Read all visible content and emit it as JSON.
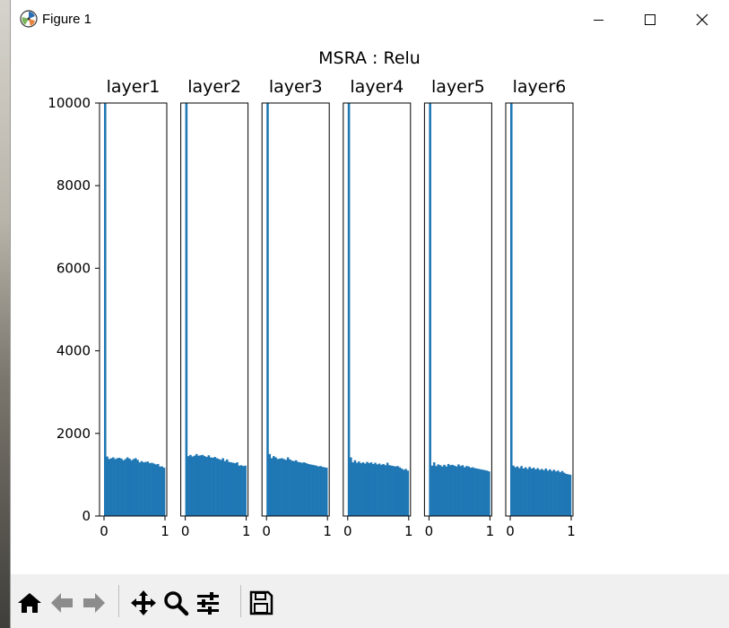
{
  "window": {
    "title": "Figure 1",
    "coords": ""
  },
  "toolbar": {
    "buttons": [
      {
        "name": "home",
        "icon": "home-icon"
      },
      {
        "name": "back",
        "icon": "arrow-left-icon"
      },
      {
        "name": "forward",
        "icon": "arrow-right-icon"
      },
      {
        "name": "pan",
        "icon": "move-icon"
      },
      {
        "name": "zoom",
        "icon": "magnifier-icon"
      },
      {
        "name": "configure",
        "icon": "sliders-icon"
      },
      {
        "name": "save",
        "icon": "floppy-disk-icon"
      }
    ]
  },
  "chart_data": {
    "type": "bar",
    "suptitle": "MSRA : Relu",
    "bar_color": "#1f77b4",
    "ylim": [
      0,
      10000
    ],
    "xlim": [
      0,
      1
    ],
    "yticks": [
      0,
      2000,
      4000,
      6000,
      8000,
      10000
    ],
    "xticks": [
      0,
      1
    ],
    "bins": 30,
    "shared_y": true,
    "subplots": [
      {
        "title": "layer1",
        "values": [
          10000,
          1440,
          1380,
          1400,
          1420,
          1380,
          1400,
          1410,
          1390,
          1350,
          1380,
          1420,
          1390,
          1350,
          1380,
          1400,
          1360,
          1300,
          1330,
          1300,
          1310,
          1320,
          1280,
          1290,
          1270,
          1250,
          1260,
          1200,
          1200,
          1170
        ]
      },
      {
        "title": "layer2",
        "values": [
          10000,
          1450,
          1480,
          1440,
          1460,
          1500,
          1460,
          1470,
          1480,
          1450,
          1430,
          1470,
          1420,
          1410,
          1430,
          1400,
          1380,
          1360,
          1400,
          1330,
          1370,
          1310,
          1300,
          1290,
          1280,
          1300,
          1220,
          1230,
          1210,
          1220
        ]
      },
      {
        "title": "layer3",
        "values": [
          10000,
          1500,
          1400,
          1450,
          1420,
          1380,
          1390,
          1400,
          1380,
          1360,
          1420,
          1370,
          1340,
          1330,
          1350,
          1310,
          1300,
          1290,
          1300,
          1280,
          1260,
          1250,
          1240,
          1230,
          1220,
          1200,
          1210,
          1190,
          1180,
          1170
        ]
      },
      {
        "title": "layer4",
        "values": [
          10000,
          1420,
          1300,
          1350,
          1290,
          1320,
          1280,
          1300,
          1270,
          1310,
          1280,
          1300,
          1260,
          1290,
          1250,
          1270,
          1240,
          1260,
          1230,
          1290,
          1230,
          1220,
          1210,
          1200,
          1210,
          1180,
          1150,
          1120,
          1140,
          1100
        ]
      },
      {
        "title": "layer5",
        "values": [
          10000,
          1220,
          1300,
          1210,
          1250,
          1230,
          1200,
          1240,
          1200,
          1260,
          1230,
          1240,
          1220,
          1200,
          1250,
          1210,
          1230,
          1180,
          1210,
          1200,
          1170,
          1180,
          1160,
          1150,
          1140,
          1130,
          1120,
          1110,
          1100,
          1080
        ]
      },
      {
        "title": "layer6",
        "values": [
          10000,
          1220,
          1180,
          1200,
          1160,
          1210,
          1150,
          1180,
          1140,
          1190,
          1150,
          1170,
          1130,
          1160,
          1120,
          1140,
          1110,
          1150,
          1100,
          1130,
          1090,
          1120,
          1080,
          1100,
          1060,
          1090,
          1050,
          1020,
          1010,
          1000
        ]
      }
    ]
  }
}
